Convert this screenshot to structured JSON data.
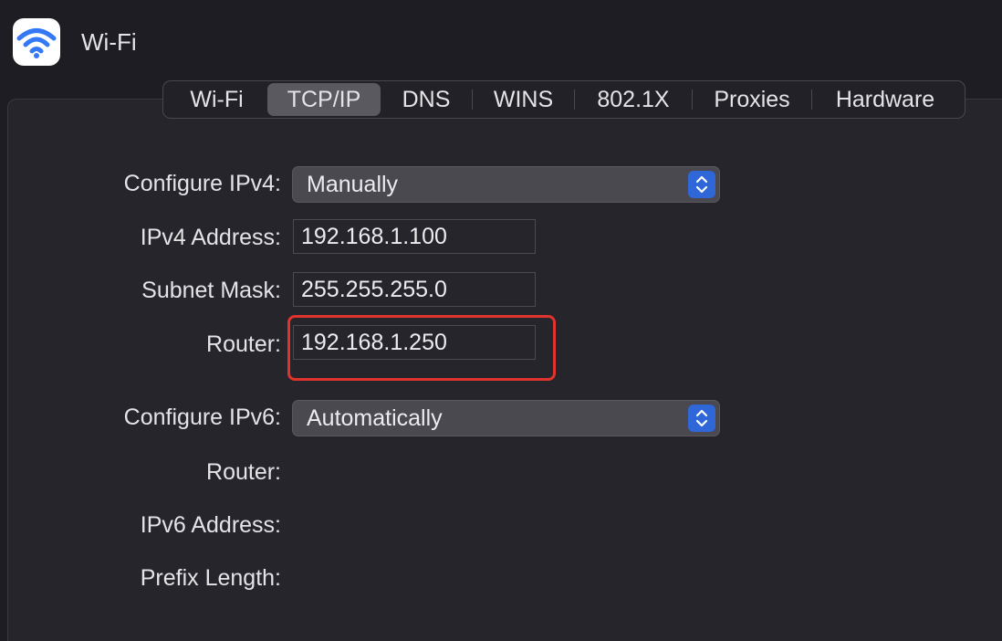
{
  "header": {
    "app_icon": "wifi-icon",
    "title": "Wi-Fi"
  },
  "tabs": [
    {
      "label": "Wi-Fi",
      "active": false
    },
    {
      "label": "TCP/IP",
      "active": true
    },
    {
      "label": "DNS",
      "active": false
    },
    {
      "label": "WINS",
      "active": false
    },
    {
      "label": "802.1X",
      "active": false
    },
    {
      "label": "Proxies",
      "active": false
    },
    {
      "label": "Hardware",
      "active": false
    }
  ],
  "form": {
    "configure_ipv4": {
      "label": "Configure IPv4:",
      "value": "Manually"
    },
    "ipv4_address": {
      "label": "IPv4 Address:",
      "value": "192.168.1.100"
    },
    "subnet_mask": {
      "label": "Subnet Mask:",
      "value": "255.255.255.0"
    },
    "router": {
      "label": "Router:",
      "value": "192.168.1.250"
    },
    "configure_ipv6": {
      "label": "Configure IPv6:",
      "value": "Automatically"
    },
    "ipv6_router": {
      "label": "Router:"
    },
    "ipv6_address": {
      "label": "IPv6 Address:"
    },
    "prefix_length": {
      "label": "Prefix Length:"
    }
  },
  "colors": {
    "accent": "#2f66d8",
    "highlight": "#e0332e",
    "background": "#1e1d23"
  },
  "icons": {
    "select_arrows": "chevron-up-down-icon"
  }
}
